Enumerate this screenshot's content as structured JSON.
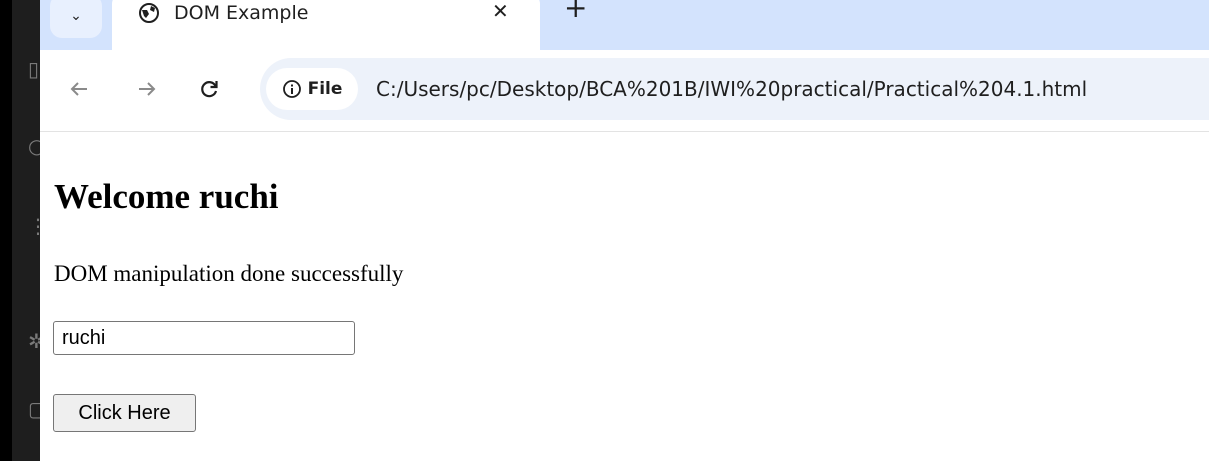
{
  "colors": {
    "chrome_bg": "#d3e3fd",
    "omnibox_bg": "#edf2fa",
    "editor_bg": "#1e1e1e",
    "page_bg": "#ffffff"
  },
  "browser": {
    "tab": {
      "title": "DOM Example",
      "favicon": "globe-icon",
      "close_glyph": "✕"
    },
    "tab_list_glyph": "⌄",
    "new_tab_glyph": "+",
    "toolbar": {
      "back_icon": "arrow-left-icon",
      "forward_icon": "arrow-right-icon",
      "reload_icon": "reload-icon",
      "site_info_label": "File",
      "url": "C:/Users/pc/Desktop/BCA%201B/IWI%20practical/Practical%204.1.html"
    }
  },
  "page": {
    "heading": "Welcome ruchi",
    "paragraph": "DOM manipulation done successfully",
    "name_input_value": "ruchi",
    "button_label": "Click Here"
  }
}
